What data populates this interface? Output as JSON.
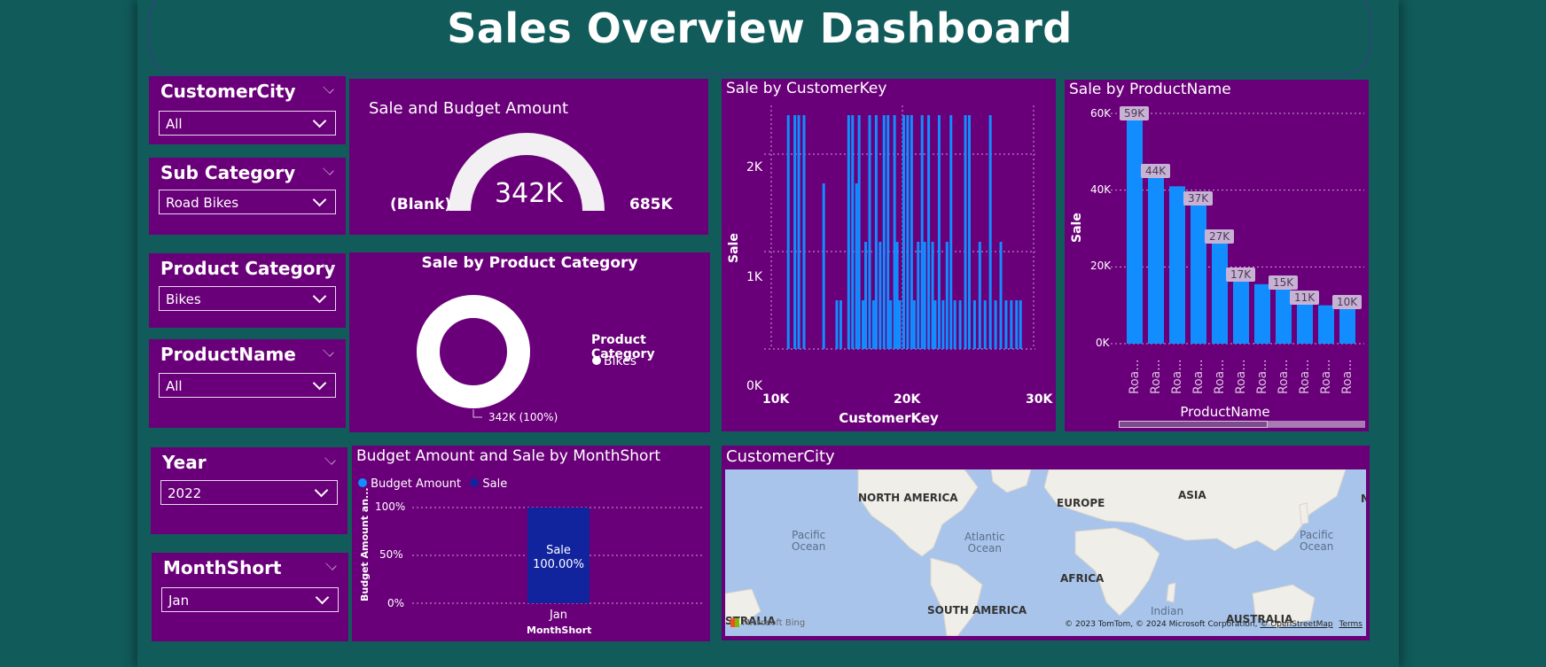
{
  "header": {
    "title": "Sales Overview Dashboard"
  },
  "slicers": [
    {
      "title": "CustomerCity",
      "value": "All"
    },
    {
      "title": "Sub Category",
      "value": "Road Bikes"
    },
    {
      "title": "Product Category",
      "value": "Bikes"
    },
    {
      "title": "ProductName",
      "value": "All"
    },
    {
      "title": "Year",
      "value": "2022"
    },
    {
      "title": "MonthShort",
      "value": "Jan"
    }
  ],
  "gauge": {
    "title": "Sale and Budget Amount",
    "value_label": "342K",
    "min_label": "(Blank)",
    "max_label": "685K",
    "fill_fraction": 0.5
  },
  "donut": {
    "title": "Sale by Product Category",
    "legend_title": "Product Category",
    "legend_item": "Bikes",
    "data_label": "342K (100%)"
  },
  "customerkey_chart": {
    "title": "Sale by CustomerKey",
    "ylabel": "Sale",
    "xlabel": "CustomerKey",
    "yticks": [
      "2K",
      "1K",
      "0K"
    ],
    "xticks": [
      "10K",
      "20K",
      "30K"
    ]
  },
  "productname_chart": {
    "title": "Sale by ProductName",
    "ylabel": "Sale",
    "xlabel": "ProductName",
    "yticks": [
      "60K",
      "40K",
      "20K",
      "0K"
    ],
    "cat_label": "Roa..."
  },
  "month_chart": {
    "title": "Budget Amount and Sale by MonthShort",
    "legend": [
      "Budget Amount",
      "Sale"
    ],
    "ylabel": "Budget Amount an...",
    "yticks": [
      "100%",
      "50%",
      "0%"
    ],
    "category": "Jan",
    "xlabel": "MonthShort",
    "bar_label_name": "Sale",
    "bar_label_value": "100.00%"
  },
  "map": {
    "title": "CustomerCity",
    "labels": {
      "north_america": "NORTH AMERICA",
      "europe": "EUROPE",
      "asia": "ASIA",
      "africa": "AFRICA",
      "south_america": "SOUTH AMERICA",
      "australia": "AUSTRALIA",
      "australia_edge": "STRALIA",
      "pacific1": "Pacific",
      "pacific2": "Ocean",
      "atlantic1": "Atlantic",
      "atlantic2": "Ocean",
      "pacific_r1": "Pacific",
      "pacific_r2": "Ocean",
      "indian1": "Indian",
      "edge_n": "N"
    },
    "bing": "Microsoft Bing",
    "attribution": "© 2023 TomTom, © 2024 Microsoft Corporation,",
    "osm": "© OpenStreetMap",
    "terms": "Terms"
  },
  "colors": {
    "background": "#125b5b",
    "panel": "#6a0079",
    "bar_blue": "#118dff",
    "bar_navy": "#12239e",
    "gauge_fill": "#f2f0f2"
  },
  "chart_data": [
    {
      "type": "bar",
      "title": "Sale by CustomerKey",
      "xlabel": "CustomerKey",
      "ylabel": "Sale",
      "xlim": [
        10000,
        30000
      ],
      "ylim": [
        0,
        2500
      ],
      "x": [
        11300,
        11800,
        12100,
        12500,
        14000,
        15000,
        15300,
        15900,
        16200,
        16500,
        16700,
        17000,
        17200,
        17500,
        17800,
        18000,
        18300,
        18600,
        18900,
        19100,
        19400,
        19600,
        19800,
        20100,
        20400,
        20700,
        20900,
        21200,
        21500,
        21700,
        22000,
        22300,
        22500,
        22800,
        23100,
        23400,
        23700,
        24000,
        24400,
        24800,
        25100,
        25500,
        25900,
        26300,
        26700,
        27100,
        27500,
        27900,
        28300,
        28700,
        29000
      ],
      "values": [
        2400,
        2400,
        2400,
        2400,
        1700,
        500,
        500,
        2400,
        2400,
        1700,
        2400,
        500,
        1100,
        2400,
        500,
        2400,
        1100,
        2400,
        2400,
        500,
        2400,
        1100,
        500,
        2400,
        2400,
        2400,
        500,
        1100,
        2400,
        1100,
        2400,
        1100,
        500,
        2400,
        500,
        1100,
        2400,
        500,
        500,
        2400,
        2400,
        500,
        1100,
        500,
        2400,
        500,
        1100,
        500,
        500,
        500,
        500
      ]
    },
    {
      "type": "bar",
      "title": "Sale by ProductName",
      "xlabel": "ProductName",
      "ylabel": "Sale",
      "ylim": [
        0,
        60000
      ],
      "categories": [
        "Roa...",
        "Roa...",
        "Roa...",
        "Roa...",
        "Roa...",
        "Roa...",
        "Roa...",
        "Roa...",
        "Roa...",
        "Roa...",
        "Roa..."
      ],
      "values": [
        59000,
        44000,
        41000,
        37000,
        27000,
        17000,
        15500,
        15000,
        11000,
        10000,
        10000
      ],
      "data_labels": [
        "59K",
        "44K",
        "",
        "37K",
        "27K",
        "17K",
        "",
        "15K",
        "11K",
        "",
        "10K"
      ]
    },
    {
      "type": "bar",
      "title": "Budget Amount and Sale by MonthShort",
      "xlabel": "MonthShort",
      "ylabel": "Budget Amount an...",
      "categories": [
        "Jan"
      ],
      "series": [
        {
          "name": "Budget Amount",
          "values": [
            0
          ]
        },
        {
          "name": "Sale",
          "values": [
            100
          ]
        }
      ],
      "ylim": [
        0,
        100
      ]
    }
  ]
}
